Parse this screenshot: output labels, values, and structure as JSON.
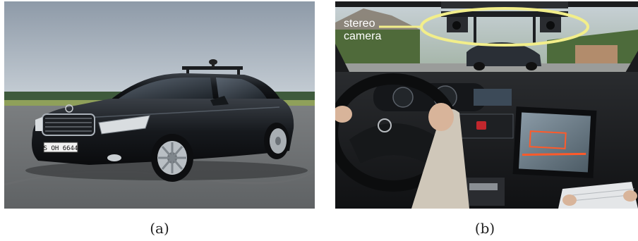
{
  "figure": {
    "panels": [
      {
        "id": "a",
        "caption": "(a)",
        "photo": {
          "subject": "black sedan with roof-mounted sensor rack on test track",
          "license_plate": "S OH 6644"
        }
      },
      {
        "id": "b",
        "caption": "(b)",
        "photo": {
          "subject": "vehicle interior with driver, dashboard display and laptop",
          "annotation_label_line1": "stereo",
          "annotation_label_line2": "camera",
          "highlight_color": "#f2ee8a"
        }
      }
    ]
  }
}
